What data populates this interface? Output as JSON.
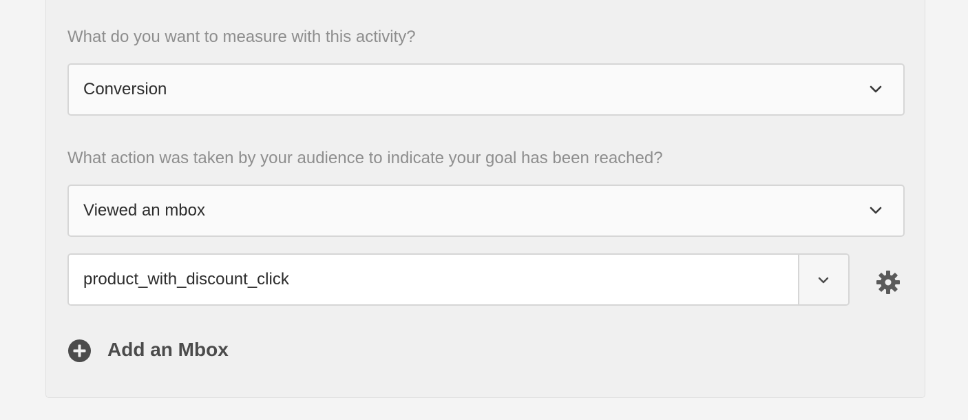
{
  "goal": {
    "measure_question": "What do you want to measure with this activity?",
    "measure_value": "Conversion",
    "action_question": "What action was taken by your audience to indicate your goal has been reached?",
    "action_value": "Viewed an mbox",
    "mbox_value": "product_with_discount_click",
    "add_mbox_label": "Add an Mbox"
  },
  "icons": {
    "dropdown": "chevron-down-icon",
    "settings": "gear-icon",
    "add": "plus-circle-icon"
  },
  "colors": {
    "panel_bg": "#f0f0f0",
    "field_border": "#d6d6d6",
    "question_text": "#8e8e8e",
    "icon": "#4b4b4b"
  }
}
